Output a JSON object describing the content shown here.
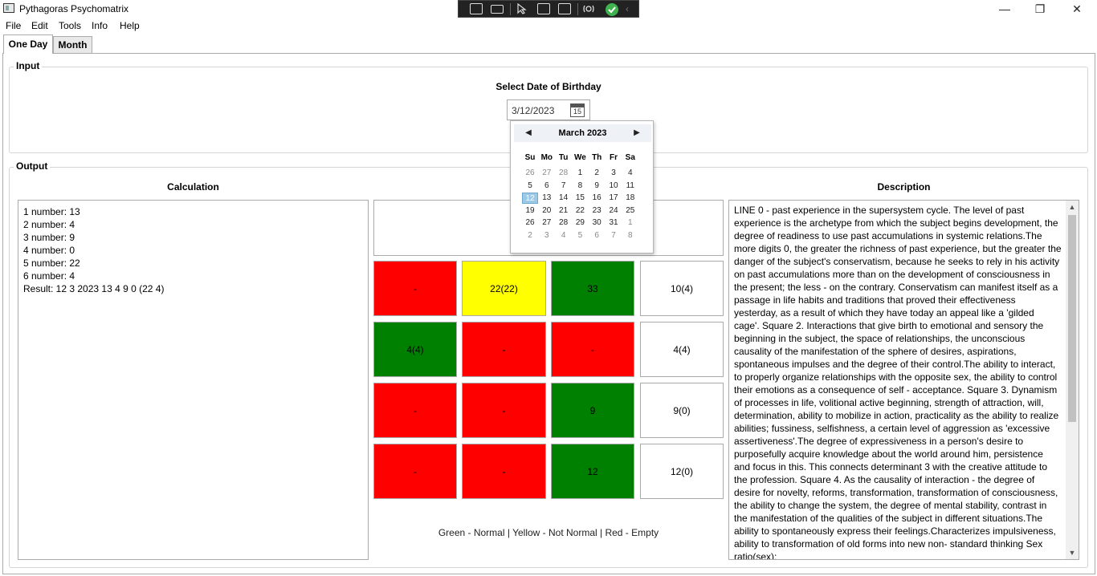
{
  "window": {
    "title": "Pythagoras Psychomatrix",
    "minimize": "—",
    "restore": "❐",
    "close": "✕"
  },
  "menu": [
    "File",
    "Edit",
    "Tools",
    "Info",
    "Help"
  ],
  "tabs": [
    {
      "label": "One Day",
      "active": true
    },
    {
      "label": "Month",
      "active": false
    }
  ],
  "input": {
    "group_title": "Input",
    "prompt": "Select Date of Birthday",
    "date_value": "3/12/2023",
    "calendar_icon_day": "15"
  },
  "calendar": {
    "month_label": "March 2023",
    "days_of_week": [
      "Su",
      "Mo",
      "Tu",
      "We",
      "Th",
      "Fr",
      "Sa"
    ],
    "weeks": [
      [
        "26",
        "27",
        "28",
        "1",
        "2",
        "3",
        "4"
      ],
      [
        "5",
        "6",
        "7",
        "8",
        "9",
        "10",
        "11"
      ],
      [
        "12",
        "13",
        "14",
        "15",
        "16",
        "17",
        "18"
      ],
      [
        "19",
        "20",
        "21",
        "22",
        "23",
        "24",
        "25"
      ],
      [
        "26",
        "27",
        "28",
        "29",
        "30",
        "31",
        "1"
      ],
      [
        "2",
        "3",
        "4",
        "5",
        "6",
        "7",
        "8"
      ]
    ],
    "selected_day": "12"
  },
  "output": {
    "group_title": "Output",
    "calculation_title": "Calculation",
    "description_title": "Description",
    "calculation_lines": [
      "1 number: 13",
      "2 number: 4",
      "3 number: 9",
      "4 number: 0",
      "5 number: 22",
      "6 number: 4",
      "Result: 12 3 2023 13 4 9 0 (22 4)"
    ],
    "matrix": [
      [
        {
          "text": "-",
          "status": "red"
        },
        {
          "text": "22(22)",
          "status": "yellow"
        },
        {
          "text": "33",
          "status": "green"
        },
        {
          "text": "10(4)",
          "status": "white"
        }
      ],
      [
        {
          "text": "4(4)",
          "status": "green"
        },
        {
          "text": "-",
          "status": "red"
        },
        {
          "text": "-",
          "status": "red"
        },
        {
          "text": "4(4)",
          "status": "white"
        }
      ],
      [
        {
          "text": "-",
          "status": "red"
        },
        {
          "text": "-",
          "status": "red"
        },
        {
          "text": "9",
          "status": "green"
        },
        {
          "text": "9(0)",
          "status": "white"
        }
      ],
      [
        {
          "text": "-",
          "status": "red"
        },
        {
          "text": "-",
          "status": "red"
        },
        {
          "text": "12",
          "status": "green"
        },
        {
          "text": "12(0)",
          "status": "white"
        }
      ]
    ],
    "legend": "Green - Normal | Yellow - Not Normal | Red - Empty",
    "description_text": "LINE 0 - past experience in the supersystem cycle. The level of past experience is the archetype from which the subject begins development, the degree of readiness to use past accumulations in systemic relations.The more digits 0, the greater the richness of past experience, but the greater the danger of the subject's conservatism, because he seeks to rely in his activity on past accumulations more than on the development of consciousness in the present; the less - on the contrary. Conservatism can manifest itself as a passage in life habits and traditions that proved their effectiveness yesterday, as a result of which they have today an appeal like a 'gilded cage'. Square 2. Interactions that give birth to emotional and sensory the beginning in the subject, the space of relationships, the unconscious causality of the manifestation of the sphere of desires, aspirations, spontaneous impulses and the degree of their control.The ability to interact, to properly organize relationships with the opposite sex, the ability to control their emotions as a consequence of self - acceptance. Square 3. Dynamism of processes in life, volitional active beginning, strength of attraction, will, determination, ability to mobilize in action, practicality as the ability to realize abilities; fussiness, selfishness, a certain level of aggression as 'excessive assertiveness'.The degree of expressiveness in a person's desire to purposefully acquire knowledge about the world around him, persistence and focus in this. This connects determinant 3 with the creative attitude to the profession. Square 4. As the causality of interaction - the degree of desire for novelty, reforms, transformation, transformation of consciousness, the ability to change the system, the degree of mental stability, contrast in the manifestation of the qualities of the subject in different situations.The ability to spontaneously express their feelings.Characterizes impulsiveness, ability to transformation of old forms into new non- standard thinking Sex ratio(sex):"
  },
  "colors": {
    "green": "#008000",
    "red": "#ff0000",
    "yellow": "#ffff00",
    "white": "#ffffff",
    "selected_day": "#9cc9e6"
  }
}
